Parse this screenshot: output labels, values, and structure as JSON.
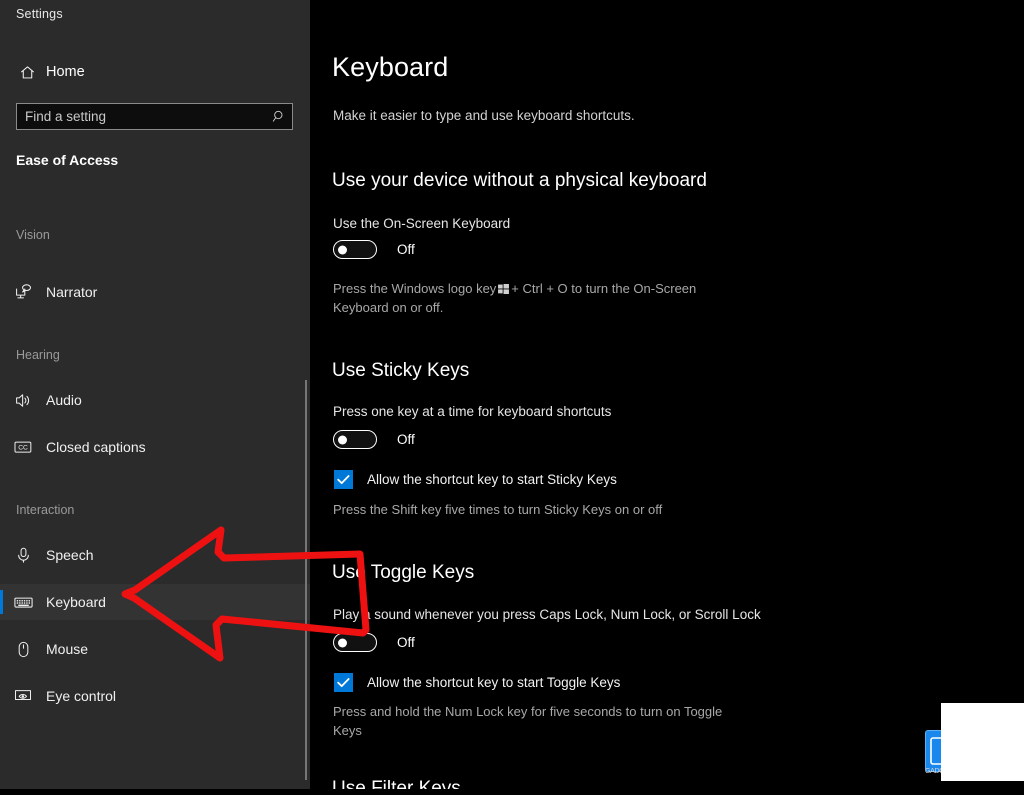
{
  "window": {
    "app_title": "Settings"
  },
  "sidebar": {
    "home_label": "Home",
    "home_icon": "home-icon",
    "search": {
      "placeholder": "Find a setting",
      "value": "",
      "icon": "search-icon"
    },
    "category_title": "Ease of Access",
    "groups": [
      {
        "header": "Vision",
        "items": [
          {
            "label": "Narrator",
            "icon": "narrator-icon",
            "selected": false
          }
        ]
      },
      {
        "header": "Hearing",
        "items": [
          {
            "label": "Audio",
            "icon": "audio-speaker-icon",
            "selected": false
          },
          {
            "label": "Closed captions",
            "icon": "closed-captions-icon",
            "selected": false
          }
        ]
      },
      {
        "header": "Interaction",
        "items": [
          {
            "label": "Speech",
            "icon": "microphone-icon",
            "selected": false
          },
          {
            "label": "Keyboard",
            "icon": "keyboard-icon",
            "selected": true
          },
          {
            "label": "Mouse",
            "icon": "mouse-icon",
            "selected": false
          },
          {
            "label": "Eye control",
            "icon": "eye-control-icon",
            "selected": false
          }
        ]
      }
    ],
    "accent_color": "#0078d7",
    "background_color": "#2b2b2b"
  },
  "main": {
    "title": "Keyboard",
    "subtitle": "Make it easier to type and use keyboard shortcuts.",
    "sections": [
      {
        "heading": "Use your device without a physical keyboard",
        "setting_label": "Use the On-Screen Keyboard",
        "toggle_state": "Off",
        "hint_before_key": "Press the Windows logo key",
        "hint_after_key": "+ Ctrl + O to turn the On-Screen Keyboard on or off."
      },
      {
        "heading": "Use Sticky Keys",
        "setting_label": "Press one key at a time for keyboard shortcuts",
        "toggle_state": "Off",
        "checkbox_label": "Allow the shortcut key to start Sticky Keys",
        "checkbox_checked": true,
        "hint": "Press the Shift key five times to turn Sticky Keys on or off"
      },
      {
        "heading": "Use Toggle Keys",
        "setting_label": "Play a sound whenever you press Caps Lock, Num Lock, or Scroll Lock",
        "toggle_state": "Off",
        "checkbox_label": "Allow the shortcut key to start Toggle Keys",
        "checkbox_checked": true,
        "hint": "Press and hold the Num Lock key for five seconds to turn on Toggle Keys"
      },
      {
        "heading": "Use Filter Keys"
      }
    ]
  },
  "annotation": {
    "arrow": "red-left-arrow",
    "arrow_color": "#ee1111"
  },
  "watermark": {
    "caption": "GADGETS"
  }
}
